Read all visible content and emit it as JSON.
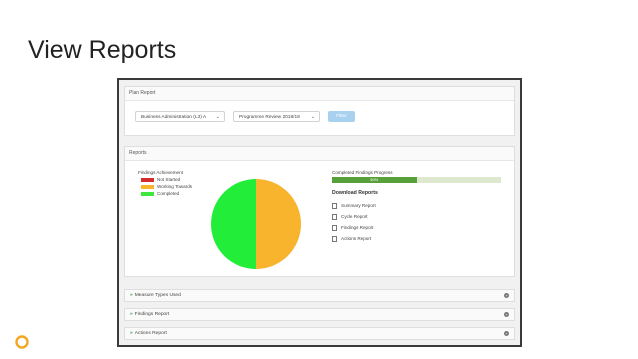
{
  "slide": {
    "title": "View Reports"
  },
  "plan_report": {
    "heading": "Plan Report",
    "course_select": "Business Administration (L3) A",
    "review_select": "Programme Review 2018/19",
    "filter_label": "Filter"
  },
  "reports": {
    "heading": "Reports",
    "findings_title": "Findings Achievement",
    "legend": [
      {
        "label": "Not Started",
        "color": "#d42b2b"
      },
      {
        "label": "Working Towards",
        "color": "#f7b42c"
      },
      {
        "label": "Completed",
        "color": "#3ee63e"
      }
    ],
    "progress_title": "Completed Findings Progress",
    "progress_value_text": "50%",
    "progress_fraction": 0.5,
    "download_heading": "Download Reports",
    "download_links": [
      "Summary Report",
      "Cycle Report",
      "Findings Report",
      "Actions Report"
    ],
    "pie": {
      "values": [
        0.5,
        0.5
      ],
      "colors": [
        "#f7b42c",
        "#22ee3a"
      ]
    }
  },
  "sections": [
    "Measure Types Used",
    "Findings Report",
    "Actions Report"
  ]
}
